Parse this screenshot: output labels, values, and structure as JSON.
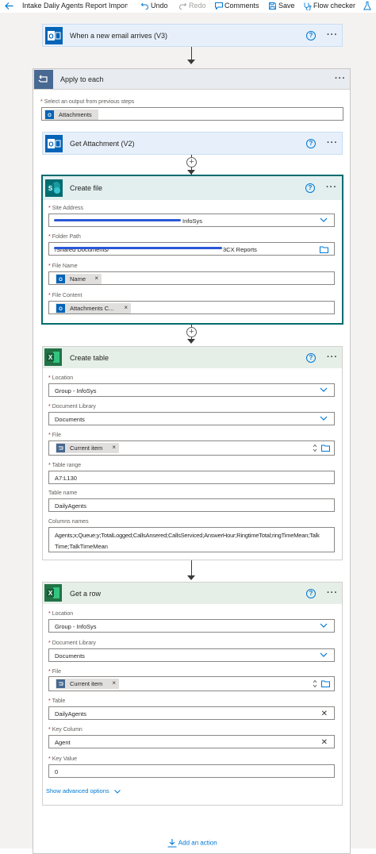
{
  "toolbar": {
    "title": "Intake Daliy Agents Report Import",
    "undo": "Undo",
    "redo": "Redo",
    "comments": "Comments",
    "save": "Save",
    "flow_checker": "Flow checker"
  },
  "trigger": {
    "title": "When a new email arrives (V3)",
    "help": "?",
    "more": "···"
  },
  "apply_each": {
    "title": "Apply to each",
    "more": "···",
    "select_label": "Select an output from previous steps",
    "select_token": "Attachments"
  },
  "get_attachment": {
    "title": "Get Attachment (V2)",
    "help": "?",
    "more": "···"
  },
  "create_file": {
    "title": "Create file",
    "help": "?",
    "more": "···",
    "site_label": "Site Address",
    "site_value": "InfoSys",
    "folder_label": "Folder Path",
    "folder_value_start": "/Shared Documents/",
    "folder_value_end": "3CX Reports",
    "name_label": "File Name",
    "name_token": "Name",
    "content_label": "File Content",
    "content_token": "Attachments C..."
  },
  "create_table": {
    "title": "Create table",
    "help": "?",
    "more": "···",
    "location_label": "Location",
    "location_value": "Group - InfoSys",
    "library_label": "Document Library",
    "library_value": "Documents",
    "file_label": "File",
    "file_token": "Current item",
    "range_label": "Table range",
    "range_value": "A7:L130",
    "name_label": "Table name",
    "name_value": "DailyAgents",
    "columns_label": "Columns names",
    "columns_line1": "Agents;x;Queue;y;TotalLogged;CallsAnsered;CallsServiced;AnswerHour;RingtimeTotal;ringTimeMean;Talk",
    "columns_line2": "Time;TalkTimeMean"
  },
  "get_row": {
    "title": "Get a row",
    "help": "?",
    "more": "···",
    "location_label": "Location",
    "location_value": "Group - InfoSys",
    "library_label": "Document Library",
    "library_value": "Documents",
    "file_label": "File",
    "file_token": "Current item",
    "table_label": "Table",
    "table_value": "DailyAgents",
    "keycol_label": "Key Column",
    "keycol_value": "Agent",
    "keyval_label": "Key Value",
    "keyval_value": "0",
    "advanced": "Show advanced options"
  },
  "add_action": "Add an action",
  "colors": {
    "outlook_blue": "#0364b8",
    "sharepoint_teal": "#036c70",
    "excel_green": "#217346",
    "loop_blue": "#486991",
    "accent": "#0078d4"
  }
}
